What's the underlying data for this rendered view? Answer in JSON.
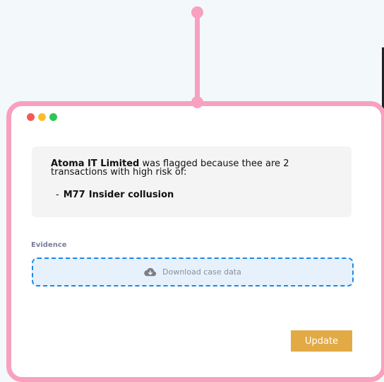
{
  "window": {
    "controls": [
      "close",
      "minimize",
      "maximize"
    ]
  },
  "info": {
    "company": "Atoma IT Limited",
    "message": "was flagged because thee are 2 transactions with high risk of:",
    "risk": {
      "bullet": "-",
      "code": "M77",
      "name": "Insider collusion"
    }
  },
  "evidence": {
    "label": "Evidence",
    "download_label": "Download case data",
    "icon": "cloud-download-icon"
  },
  "actions": {
    "update_label": "Update"
  },
  "colors": {
    "accent_pink": "#f7a1bf",
    "button": "#e2aa45",
    "upload_border": "#1e88e5",
    "upload_bg": "#e6f1fb"
  }
}
